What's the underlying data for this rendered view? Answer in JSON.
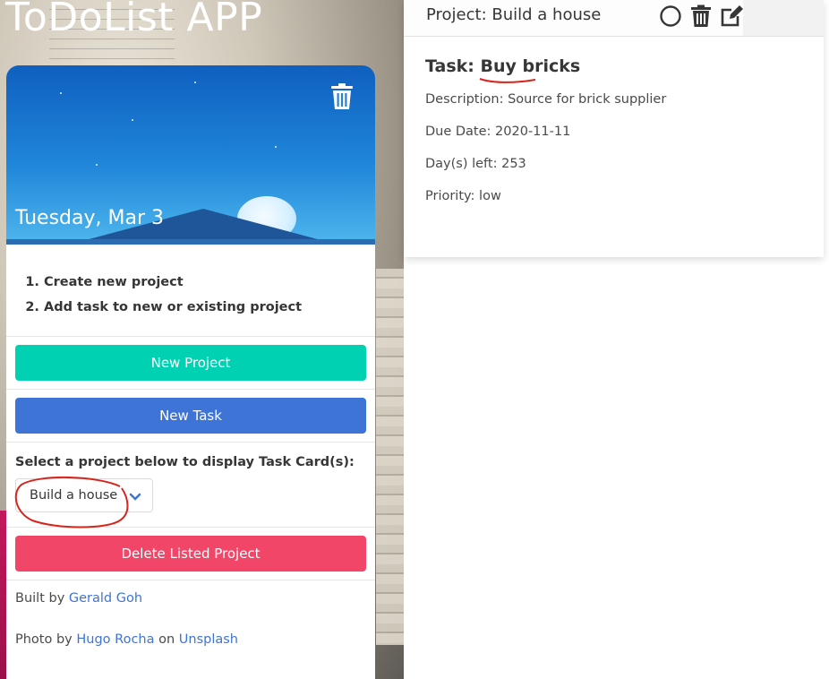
{
  "app": {
    "title": "ToDoList APP"
  },
  "hero": {
    "date": "Tuesday, Mar 3"
  },
  "instructions": [
    "Create new project",
    "Add task to new or existing project"
  ],
  "buttons": {
    "new_project": "New Project",
    "new_task": "New Task",
    "delete_project": "Delete Listed Project"
  },
  "project_select": {
    "label": "Select a project below to display Task Card(s):",
    "selected": "Build a house"
  },
  "footer": {
    "built_prefix": "Built by",
    "author": "Gerald Goh",
    "photo_prefix": "Photo by",
    "photographer": "Hugo Rocha",
    "on_word": "on",
    "platform": "Unsplash"
  },
  "task_panel": {
    "project_title": "Project: Build a house",
    "task_label": "Task:",
    "task_name": "Buy bricks",
    "description": "Description: Source for brick supplier",
    "due_date": "Due Date: 2020-11-11",
    "days_left": "Day(s) left: 253",
    "priority": "Priority: low"
  },
  "icons": {
    "delete_card": "trash-icon",
    "complete": "circle-icon",
    "delete_task": "trash-icon",
    "edit": "edit-icon",
    "dropdown": "chevron-down-icon"
  },
  "colors": {
    "primary": "#00d1b2",
    "link": "#3e74d6",
    "danger": "#f14668",
    "annotation": "#d9241b"
  }
}
